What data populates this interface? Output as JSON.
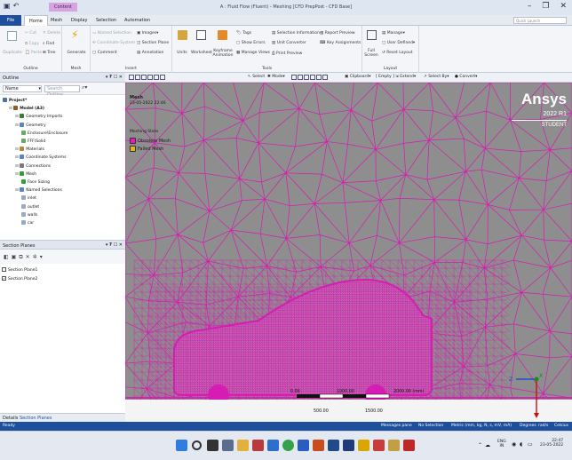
{
  "window": {
    "title": "A : Fluid Flow (Fluent) - Meshing [CFD PrepPost - CFD Base]",
    "context_tab": "Content",
    "minimize": "–",
    "restore": "❐",
    "close": "✕"
  },
  "ribbon_tabs": [
    "File",
    "Home",
    "Mesh",
    "Display",
    "Selection",
    "Automation"
  ],
  "search_placeholder": "Quick Launch",
  "ribbon": {
    "outline": {
      "duplicate": "Duplicate",
      "cut": "Cut",
      "copy": "Copy",
      "paste": "Paste",
      "delete": "Delete",
      "find": "Find",
      "tree": "Tree",
      "label": "Outline"
    },
    "mesh": {
      "generate": "Generate",
      "label": "Mesh"
    },
    "insert": {
      "named_selection": "Named Selection",
      "coordinate_system": "Coordinate System",
      "comment": "Comment",
      "images": "Images",
      "section_plane": "Section Plane",
      "annotation": "Annotation",
      "label": "Insert"
    },
    "tools": {
      "units": "Units",
      "worksheet": "Worksheet",
      "keyframe": "Keyframe Animation",
      "tags": "Tags",
      "show_errors": "Show Errors",
      "manage_views": "Manage Views",
      "selection_information": "Selection Information",
      "unit_converter": "Unit Converter",
      "print_preview": "Print Preview",
      "report_preview": "Report Preview",
      "key_assignments": "Key Assignments",
      "label": "Tools"
    },
    "layout": {
      "full_screen": "Full Screen",
      "manage": "Manage",
      "user_defined": "User Defined",
      "reset_layout": "Reset Layout",
      "label": "Layout"
    }
  },
  "graphics_toolbar": {
    "select": "Select",
    "mode": "Mode",
    "clipboard": "Clipboard",
    "empty": "[ Empty ]",
    "extend": "Extend",
    "select_by": "Select By",
    "convert": "Convert"
  },
  "outline": {
    "title": "Outline",
    "pin": "▾ ₮ ☐ ✕",
    "name_label": "Name",
    "search_placeholder": "Search Outline",
    "tree": [
      {
        "label": "Project*",
        "indent": 0,
        "icon": "#4a6ea9"
      },
      {
        "label": "Model (A3)",
        "indent": 1,
        "icon": "#8a5a2a"
      },
      {
        "label": "Geometry Imports",
        "indent": 2,
        "icon": "#3a7a3a"
      },
      {
        "label": "Geometry",
        "indent": 2,
        "icon": "#5a86c0"
      },
      {
        "label": "Enclosure\\Enclosure",
        "indent": 3,
        "icon": "#66aa66"
      },
      {
        "label": "FFF\\Solid",
        "indent": 3,
        "icon": "#66aa66"
      },
      {
        "label": "Materials",
        "indent": 2,
        "icon": "#b08a3a"
      },
      {
        "label": "Coordinate Systems",
        "indent": 2,
        "icon": "#5a86c0"
      },
      {
        "label": "Connections",
        "indent": 2,
        "icon": "#7a7a7a"
      },
      {
        "label": "Mesh",
        "indent": 2,
        "icon": "#3a9a3a"
      },
      {
        "label": "Face Sizing",
        "indent": 3,
        "icon": "#3a9a3a"
      },
      {
        "label": "Named Selections",
        "indent": 2,
        "icon": "#5a86c0"
      },
      {
        "label": "inlet",
        "indent": 3,
        "icon": "#9aa8c0"
      },
      {
        "label": "outlet",
        "indent": 3,
        "icon": "#9aa8c0"
      },
      {
        "label": "walls",
        "indent": 3,
        "icon": "#9aa8c0"
      },
      {
        "label": "car",
        "indent": 3,
        "icon": "#9aa8c0"
      }
    ]
  },
  "section_planes": {
    "title": "Section Planes",
    "pin": "▾ ₮ ☐ ✕",
    "items": [
      {
        "label": "Section Plane1",
        "checked": false
      },
      {
        "label": "Section Plane2",
        "checked": true
      }
    ],
    "tabs": [
      "Details",
      "Section Planes"
    ]
  },
  "viewport": {
    "title": "Mesh",
    "date": "23-05-2022 22:46",
    "legend_title": "Meshing State",
    "legend": [
      {
        "label": "Obsolete Mesh",
        "color": "#e81ab8"
      },
      {
        "label": "Failed Mesh",
        "color": "#e6b321"
      }
    ],
    "brand": "Ansys",
    "version": "2022 R1",
    "edition": "STUDENT",
    "scale_top": [
      "0.00",
      "1000.00",
      "2000.00 (mm)"
    ],
    "scale_bottom": [
      "500.00",
      "1500.00"
    ],
    "axis_z": "Z",
    "axis_x": "X",
    "mesh_color": "#d51cb3",
    "bg_color": "#8e8e8e"
  },
  "status": {
    "ready": "Ready",
    "messages": "Messages pane",
    "selection": "No Selection",
    "units": "Metric (mm, kg, N, s, mV, mA)",
    "degrees": "Degrees",
    "rads": "rad/s",
    "celsius": "Celsius"
  },
  "taskbar": {
    "lang": "ENG",
    "region": "IN",
    "time": "22:47",
    "date": "23-05-2022"
  }
}
